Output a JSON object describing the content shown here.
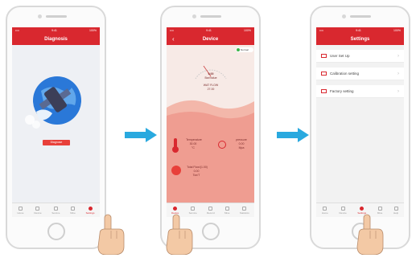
{
  "status_bar": {
    "left": "•••• ",
    "center": "9:41",
    "right": "100%"
  },
  "phone1": {
    "title": "Diagnosis",
    "button_label": "Diagnose",
    "tabs": [
      "Home",
      "Device",
      "Service",
      "Mine",
      "Settings"
    ],
    "active_tab": 4
  },
  "phone2": {
    "title": "Device",
    "badge": "Normal",
    "gauge_value": "0.00",
    "gauge_unit": "Bar/Value",
    "flow_label": "WAT FLOW",
    "flow_value": "27.00",
    "temperature_label": "Temperature",
    "temperature_value": "30.00",
    "temperature_unit": "°C",
    "pressure_label": "pressure",
    "pressure_value": "0.00",
    "pressure_unit": "Mpa",
    "total_label": "Total Flow/(1.00)",
    "total_value": "0.00",
    "total_unit": "Ton/T",
    "tabs": [
      "Device",
      "Service",
      "Record",
      "Mine",
      "Statistics"
    ],
    "active_tab": 0
  },
  "phone3": {
    "title": "Settings",
    "items": [
      "User Set Up",
      "Calibration setting",
      "Factory setting"
    ],
    "tabs": [
      "Home",
      "Device",
      "Settings",
      "Mine",
      "Help"
    ],
    "active_tab": 2
  },
  "colors": {
    "brand_red": "#d9282f",
    "arrow_blue": "#29a9df",
    "hand_skin": "#f3c9a5"
  }
}
